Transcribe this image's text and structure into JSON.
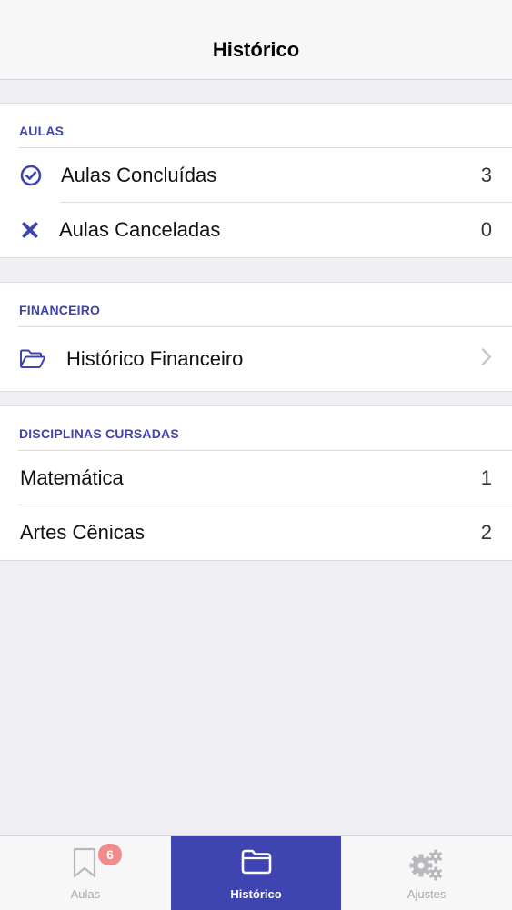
{
  "header": {
    "title": "Histórico"
  },
  "sections": {
    "aulas": {
      "title": "AULAS",
      "rows": [
        {
          "label": "Aulas Concluídas",
          "value": "3",
          "icon": "check-circle-icon"
        },
        {
          "label": "Aulas Canceladas",
          "value": "0",
          "icon": "x-icon"
        }
      ]
    },
    "financeiro": {
      "title": "FINANCEIRO",
      "rows": [
        {
          "label": "Histórico Financeiro",
          "icon": "folder-open-icon"
        }
      ]
    },
    "disciplinas": {
      "title": "DISCIPLINAS CURSADAS",
      "rows": [
        {
          "label": "Matemática",
          "value": "1"
        },
        {
          "label": "Artes Cênicas",
          "value": "2"
        }
      ]
    }
  },
  "tabbar": {
    "tabs": [
      {
        "label": "Aulas",
        "icon": "bookmark-icon",
        "badge": "6",
        "active": false
      },
      {
        "label": "Histórico",
        "icon": "folder-icon",
        "active": true
      },
      {
        "label": "Ajustes",
        "icon": "gears-icon",
        "active": false
      }
    ]
  },
  "colors": {
    "accent": "#3f45b0",
    "badge": "#f28b8b",
    "background": "#efeff4"
  }
}
